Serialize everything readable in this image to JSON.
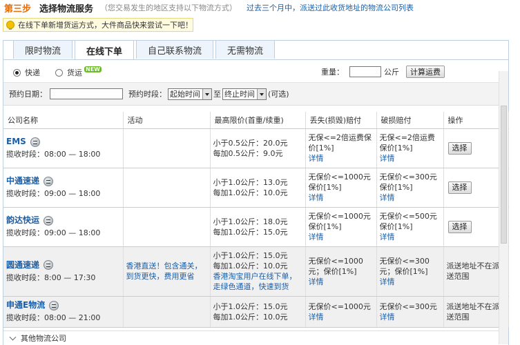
{
  "header": {
    "step": "第三步",
    "title": "选择物流服务",
    "desc": "（您交易发生的地区支持以下物流方式）",
    "link": "过去三个月中，派送过此收货地址的物流公司列表"
  },
  "tip": "在线下单新增货运方式，大件商品快来尝试一下吧！",
  "tabs": [
    "限时物流",
    "在线下单",
    "自己联系物流",
    "无需物流"
  ],
  "active_tab": "在线下单",
  "shipping_types": {
    "express": "快递",
    "freight": "货运",
    "new_badge": "NEW"
  },
  "weight": {
    "label": "重量：",
    "unit": "公斤",
    "button": "计算运费",
    "value": ""
  },
  "booking": {
    "date_label": "预约日期：",
    "time_label": "预约时段：",
    "start": "起始时间",
    "to": "至",
    "end": "终止时间",
    "optional": "(可选)",
    "date_value": ""
  },
  "table": {
    "headers": [
      "公司名称",
      "活动",
      "最高限价(首重/续重)",
      "丢失(损毁)赔付",
      "破损赔付",
      "操作"
    ],
    "rows": [
      {
        "name": "EMS",
        "hours": "揽收时段：08:00 — 18:00",
        "activity": "",
        "price": [
          "小于0.5公斤：20.0元",
          "每加0.5公斤：9.0元"
        ],
        "loss": [
          "无保<=2倍运费保价[1%]",
          "详情"
        ],
        "damage": [
          "无保<=2倍运费保价[1%]",
          "详情"
        ],
        "action": "选择"
      },
      {
        "name": "中通速递",
        "hours": "揽收时段：09:00 — 18:00",
        "activity": "",
        "price": [
          "小于1.0公斤：13.0元",
          "每加1.0公斤：10.0元"
        ],
        "loss": [
          "无保价<=1000元保价[1%]",
          "详情"
        ],
        "damage": [
          "无保价<=300元保价[1%]",
          "详情"
        ],
        "action": "选择"
      },
      {
        "name": "韵达快运",
        "hours": "揽收时段：09:00 — 18:00",
        "activity": "",
        "price": [
          "小于1.0公斤：18.0元",
          "每加1.0公斤：15.0元"
        ],
        "loss": [
          "无保价<=1000元保价[1%]",
          "详情"
        ],
        "damage": [
          "无保价<=500元保价[1%]",
          "详情"
        ],
        "action": "选择"
      },
      {
        "name": "圆通速递",
        "hours": "揽收时段：8:00 — 17:30",
        "activity": "香港直送！包含通关，到货更快，费用更省",
        "price": [
          "小于1.0公斤：15.0元",
          "每加1.0公斤：10.0元"
        ],
        "price_note": "香港淘宝用户在线下单，走绿色通道，快速到货",
        "loss": [
          "无保价<=1000元；保价[1%]",
          "详情"
        ],
        "damage": [
          "无保价<=300元；保价[1%]",
          "详情"
        ],
        "action": "派送地址不在派送范围"
      },
      {
        "name": "申通E物流",
        "hours": "揽收时段：08:00 — 21:00",
        "activity": "",
        "price": [
          "小于1.0公斤：15.0元",
          "每加1.0公斤：10.0元"
        ],
        "loss": [
          "无保价<=1000元",
          "详情"
        ],
        "damage": [
          "无保价<=300元",
          "详情"
        ],
        "action": "派送地址不在派送范围"
      }
    ]
  },
  "footer": "其他物流公司"
}
